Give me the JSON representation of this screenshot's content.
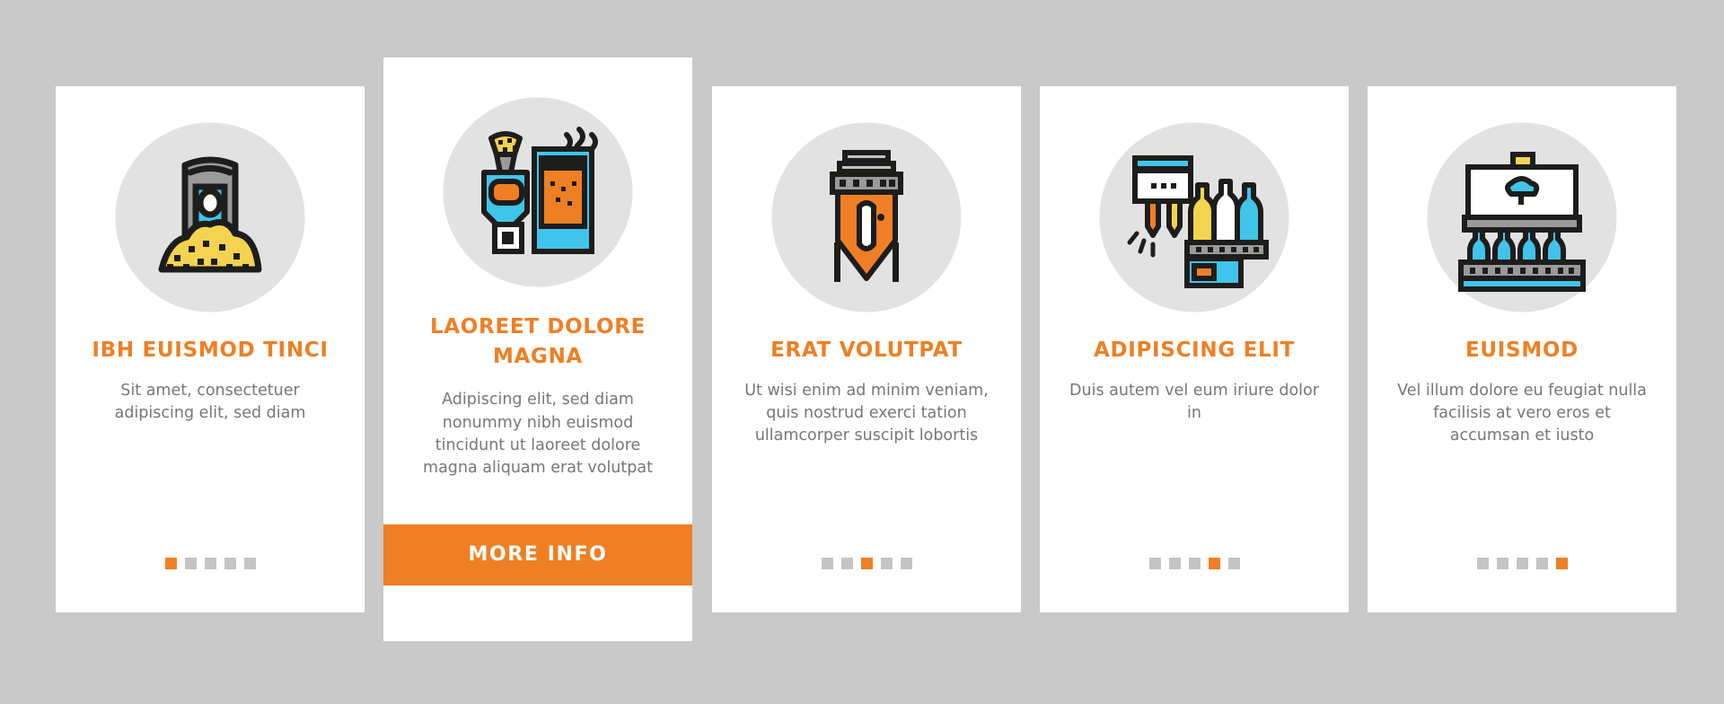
{
  "theme": {
    "background": "#c9c9c9",
    "card_background": "#ffffff",
    "accent": "#ef7f24",
    "title_color": "#ef7f24",
    "body_text_color": "#76777a",
    "icon_disc_color": "#e2e2e2",
    "icon_cyan": "#41c4ea",
    "icon_orange": "#ef7f24",
    "icon_yellow": "#f3d34f",
    "icon_gray": "#9a9a9a",
    "icon_outline": "#1d1d1b",
    "dot_inactive": "#c4c4c4"
  },
  "cards": [
    {
      "id": "card-1",
      "icon_name": "grain-sack-icon",
      "title": "IBH EUISMOD TINCI",
      "description": "Sit amet, consectetuer adipiscing elit, sed diam",
      "dots": {
        "count": 5,
        "active_index": 0
      },
      "has_button": false
    },
    {
      "id": "card-2",
      "icon_name": "brewing-mash-tun-icon",
      "title": "LAOREET DOLORE MAGNA",
      "description": "Adipiscing elit, sed diam nonummy nibh euismod tincidunt ut laoreet dolore magna aliquam erat volutpat",
      "dots": {
        "count": 5,
        "active_index": 1
      },
      "has_button": true,
      "button_label": "MORE INFO"
    },
    {
      "id": "card-3",
      "icon_name": "fermentation-tank-icon",
      "title": "ERAT VOLUTPAT",
      "description": "Ut wisi enim ad minim veniam, quis nostrud exerci tation ullamcorper suscipit lobortis",
      "dots": {
        "count": 5,
        "active_index": 2
      },
      "has_button": false
    },
    {
      "id": "card-4",
      "icon_name": "bottle-filling-machine-icon",
      "title": "ADIPISCING ELIT",
      "description": "Duis autem vel eum iriure dolor in",
      "dots": {
        "count": 5,
        "active_index": 3
      },
      "has_button": false
    },
    {
      "id": "card-5",
      "icon_name": "bottle-conveyor-line-icon",
      "title": "EUISMOD",
      "description": "Vel illum dolore eu feugiat nulla facilisis at vero eros et accumsan et iusto",
      "dots": {
        "count": 5,
        "active_index": 4
      },
      "has_button": false
    }
  ]
}
